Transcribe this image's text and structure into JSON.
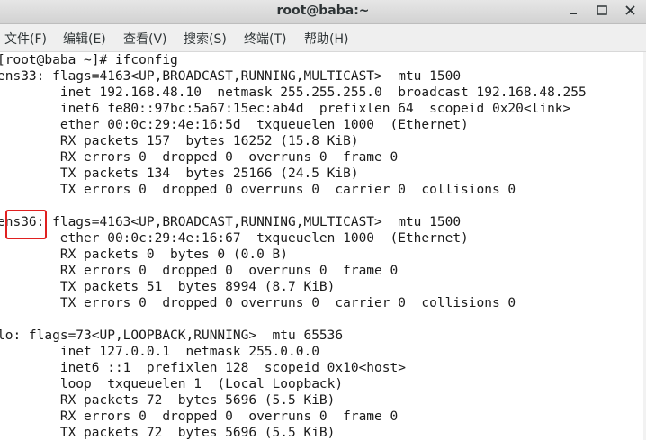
{
  "window": {
    "title": "root@baba:~",
    "controls": {
      "minimize_icon": "minimize-icon",
      "maximize_icon": "maximize-icon",
      "close_icon": "close-icon"
    }
  },
  "menubar": {
    "items": [
      {
        "label": "文件(F)"
      },
      {
        "label": "编辑(E)"
      },
      {
        "label": "查看(V)"
      },
      {
        "label": "搜索(S)"
      },
      {
        "label": "终端(T)"
      },
      {
        "label": "帮助(H)"
      }
    ]
  },
  "terminal": {
    "lines": [
      "[root@baba ~]# ifconfig",
      "ens33: flags=4163<UP,BROADCAST,RUNNING,MULTICAST>  mtu 1500",
      "        inet 192.168.48.10  netmask 255.255.255.0  broadcast 192.168.48.255",
      "        inet6 fe80::97bc:5a67:15ec:ab4d  prefixlen 64  scopeid 0x20<link>",
      "        ether 00:0c:29:4e:16:5d  txqueuelen 1000  (Ethernet)",
      "        RX packets 157  bytes 16252 (15.8 KiB)",
      "        RX errors 0  dropped 0  overruns 0  frame 0",
      "        TX packets 134  bytes 25166 (24.5 KiB)",
      "        TX errors 0  dropped 0 overruns 0  carrier 0  collisions 0",
      "",
      "ens36: flags=4163<UP,BROADCAST,RUNNING,MULTICAST>  mtu 1500",
      "        ether 00:0c:29:4e:16:67  txqueuelen 1000  (Ethernet)",
      "        RX packets 0  bytes 0 (0.0 B)",
      "        RX errors 0  dropped 0  overruns 0  frame 0",
      "        TX packets 51  bytes 8994 (8.7 KiB)",
      "        TX errors 0  dropped 0 overruns 0  carrier 0  collisions 0",
      "",
      "lo: flags=73<UP,LOOPBACK,RUNNING>  mtu 65536",
      "        inet 127.0.0.1  netmask 255.0.0.0",
      "        inet6 ::1  prefixlen 128  scopeid 0x10<host>",
      "        loop  txqueuelen 1  (Local Loopback)",
      "        RX packets 72  bytes 5696 (5.5 KiB)",
      "        RX errors 0  dropped 0  overruns 0  frame 0",
      "        TX packets 72  bytes 5696 (5.5 KiB)"
    ],
    "annotation_color": "#e02020"
  }
}
